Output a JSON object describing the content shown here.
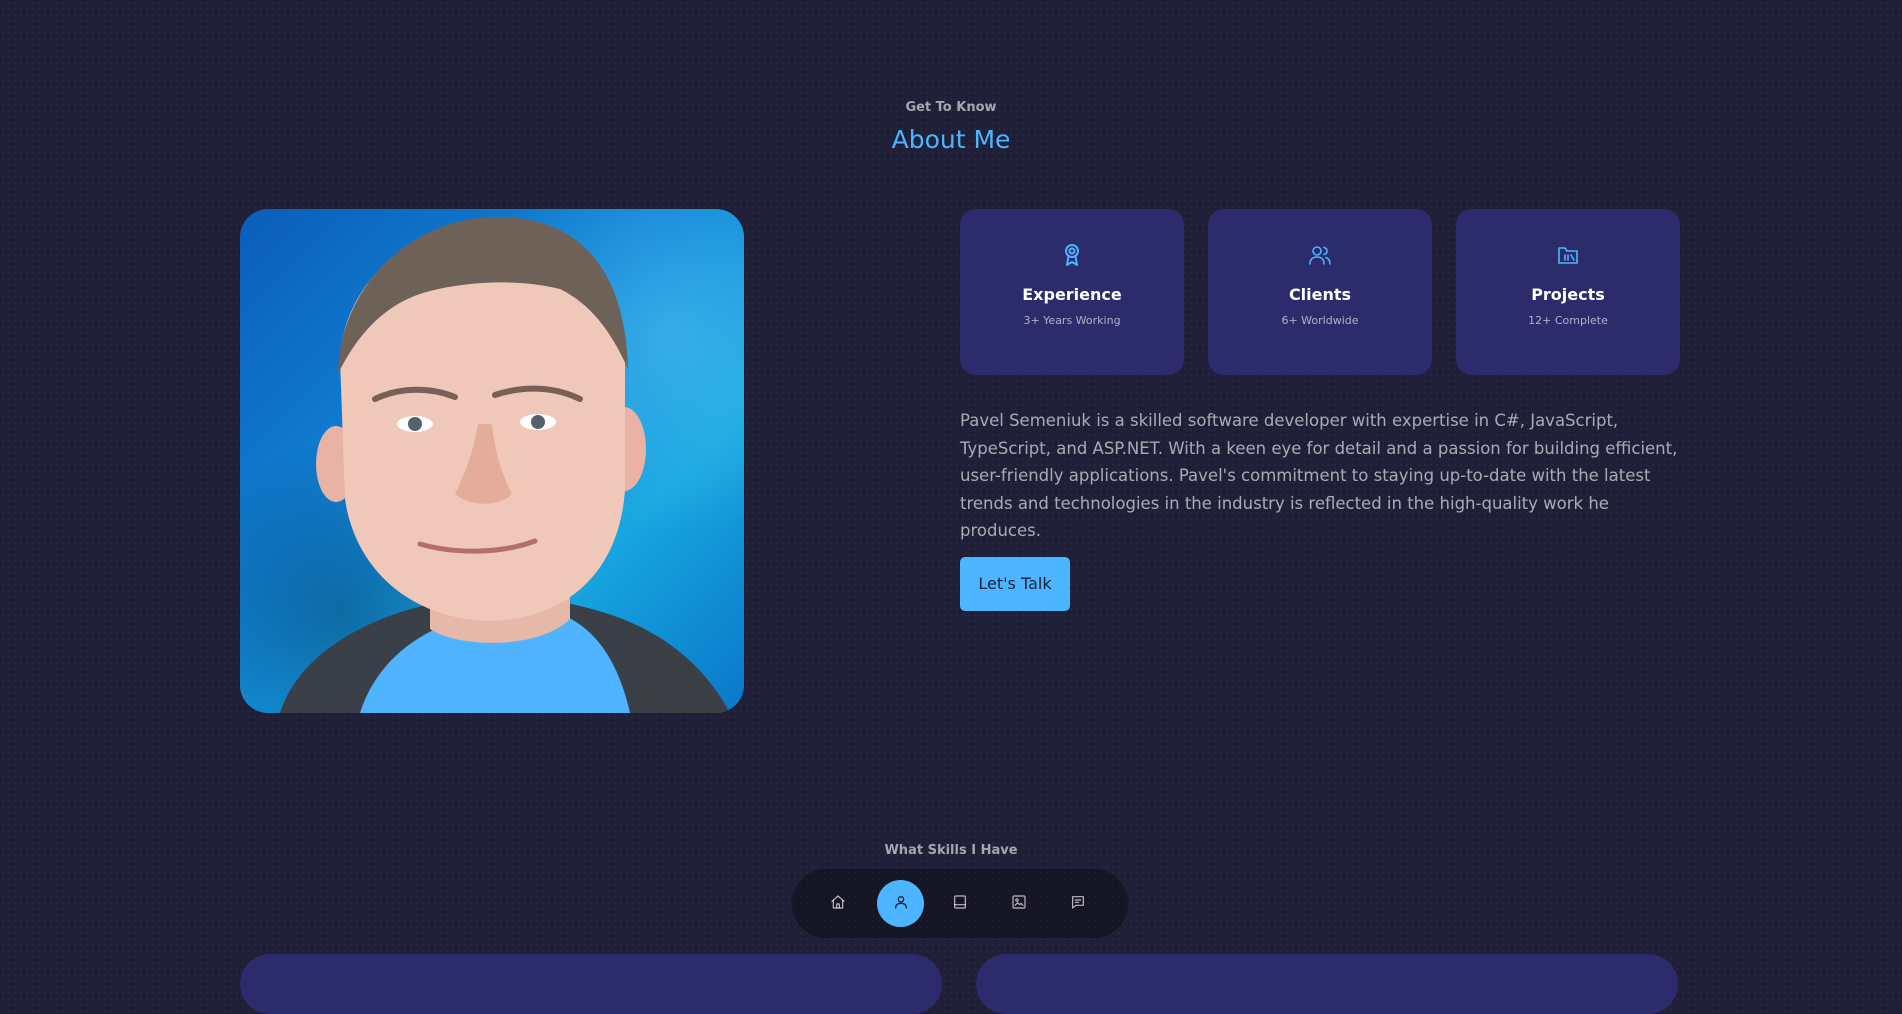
{
  "about": {
    "kicker": "Get To Know",
    "title": "About Me"
  },
  "cards": [
    {
      "icon": "award-icon",
      "title": "Experience",
      "subtitle": "3+ Years Working"
    },
    {
      "icon": "users-icon",
      "title": "Clients",
      "subtitle": "6+ Worldwide"
    },
    {
      "icon": "folder-icon",
      "title": "Projects",
      "subtitle": "12+ Complete"
    }
  ],
  "bio": "Pavel Semeniuk is a skilled software developer with expertise in C#, JavaScript, TypeScript, and ASP.NET. With a keen eye for detail and a passion for building efficient, user-friendly applications. Pavel's commitment to staying up-to-date with the latest trends and technologies in the industry is reflected in the high-quality work he produces.",
  "cta_label": "Let's Talk",
  "skills": {
    "kicker": "What Skills I Have"
  },
  "nav": {
    "items": [
      {
        "icon": "home-icon",
        "active": false
      },
      {
        "icon": "user-icon",
        "active": true
      },
      {
        "icon": "book-icon",
        "active": false
      },
      {
        "icon": "image-icon",
        "active": false
      },
      {
        "icon": "message-icon",
        "active": false
      }
    ]
  },
  "colors": {
    "background": "#1f1f38",
    "card": "#2c2c6c",
    "accent": "#4db5ff",
    "text_muted": "#a1a1b6"
  }
}
